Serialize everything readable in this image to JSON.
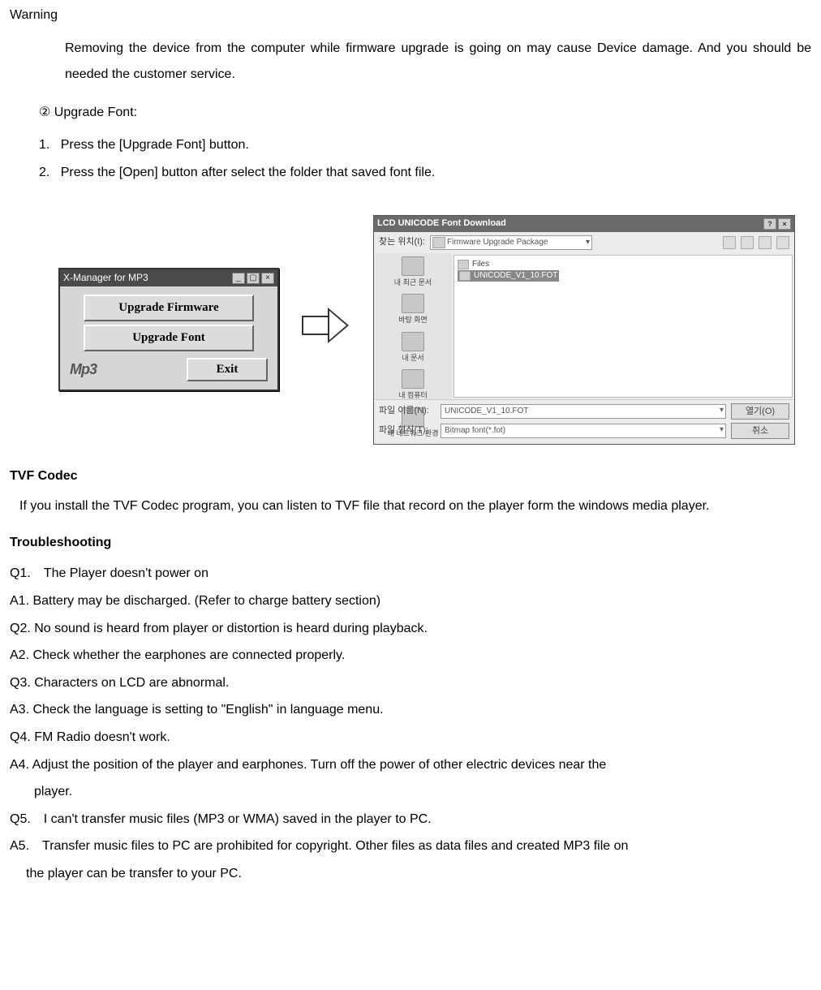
{
  "warning": {
    "title": "Warning",
    "body": "Removing the device from the computer while firmware upgrade is going on may cause Device damage. And you should be needed the customer service."
  },
  "upgrade_font": {
    "marker": "②",
    "heading": "Upgrade Font:",
    "step1_num": "1.",
    "step1": "Press the [Upgrade Font] button.",
    "step2_num": "2.",
    "step2": "Press the [Open] button after select the folder that saved font file."
  },
  "xmanager": {
    "title": "X-Manager for MP3",
    "btn_firmware": "Upgrade Firmware",
    "btn_font": "Upgrade Font",
    "logo": "Mp3",
    "btn_exit": "Exit"
  },
  "dialog": {
    "title": "LCD UNICODE Font Download",
    "lookin_label": "찾는 위치(I):",
    "lookin_value": "Firmware Upgrade Package",
    "side": [
      "내 최근 문서",
      "바탕 화면",
      "내 문서",
      "내 컴퓨터",
      "내 네트워크 환경"
    ],
    "folder": "Files",
    "selected_file": "UNICODE_V1_10.FOT",
    "filename_label": "파일 이름(N):",
    "filename_value": "UNICODE_V1_10.FOT",
    "filetype_label": "파일 형식(T):",
    "filetype_value": "Bitmap font(*.fot)",
    "open_btn": "열기(O)",
    "cancel_btn": "취소"
  },
  "tvf": {
    "heading": "TVF Codec",
    "body": "If you install the TVF Codec program, you can listen to TVF file that record on the player form the windows media player."
  },
  "troubleshooting": {
    "heading": "Troubleshooting",
    "q1": "Q1. The Player doesn't power on",
    "a1": "A1. Battery may be discharged. (Refer to charge battery section)",
    "q2": "Q2. No sound is heard from player or distortion is heard during playback.",
    "a2": "A2. Check whether the earphones are connected properly.",
    "q3": "Q3. Characters on LCD are abnormal.",
    "a3": "A3. Check the language is setting to \"English\" in language menu.",
    "q4": "Q4. FM Radio doesn't work.",
    "a4_line1": "A4. Adjust the position of the player and earphones. Turn off the power of other electric devices near the",
    "a4_line2": "player.",
    "q5": "Q5. I can't transfer music files (MP3 or WMA) saved in the player to PC.",
    "a5_line1": "A5. Transfer music files to PC are prohibited for copyright. Other files as data files and created MP3 file on",
    "a5_line2": "the player can be transfer to your PC."
  }
}
